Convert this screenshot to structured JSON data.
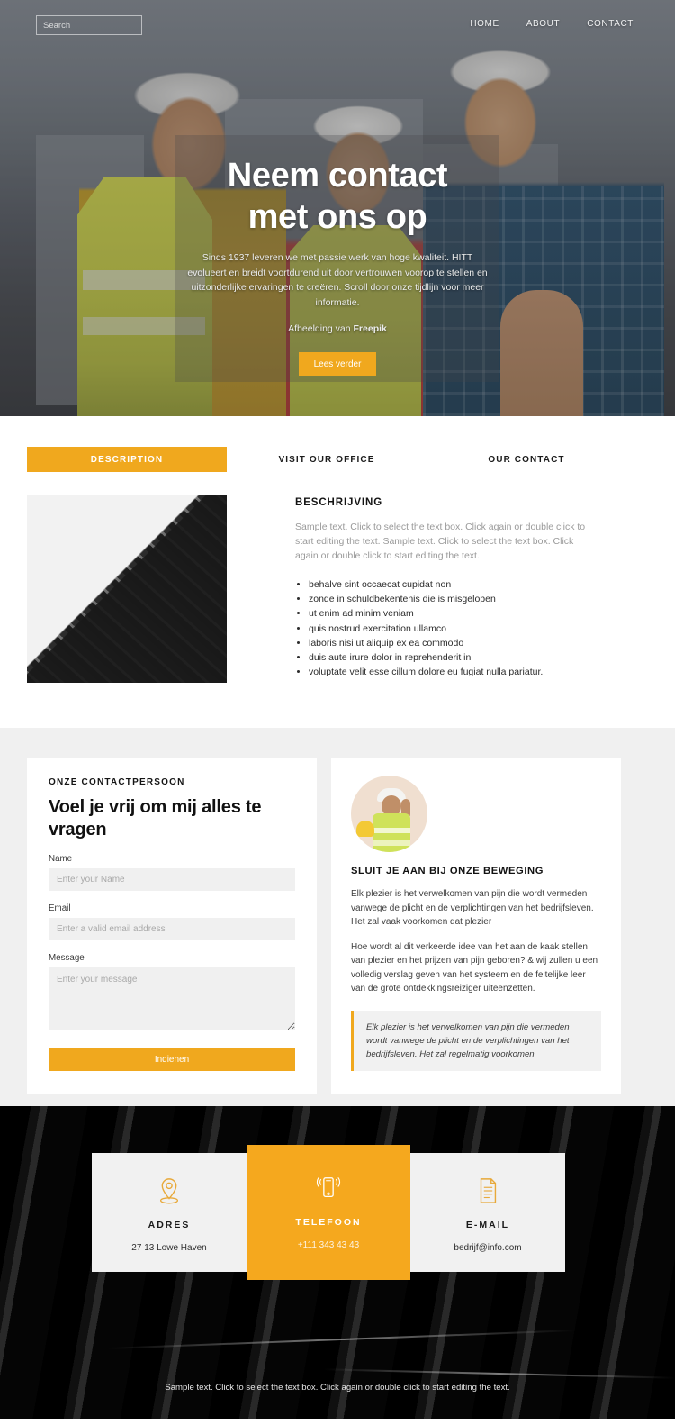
{
  "topbar": {
    "search_placeholder": "Search",
    "search_value": "",
    "nav": [
      {
        "label": "HOME"
      },
      {
        "label": "ABOUT"
      },
      {
        "label": "CONTACT"
      }
    ]
  },
  "hero": {
    "title_line1": "Neem contact",
    "title_line2": "met ons op",
    "subtitle": "Sinds 1937 leveren we met passie werk van hoge kwaliteit. HITT evolueert en breidt voortdurend uit door vertrouwen voorop te stellen en uitzonderlijke ervaringen te creëren. Scroll door onze tijdlijn voor meer informatie.",
    "credit_prefix": "Afbeelding van ",
    "credit_link": "Freepik",
    "button": "Lees verder"
  },
  "tabs": [
    {
      "label": "DESCRIPTION",
      "active": true
    },
    {
      "label": "VISIT OUR OFFICE",
      "active": false
    },
    {
      "label": "OUR CONTACT",
      "active": false
    }
  ],
  "description": {
    "heading": "BESCHRIJVING",
    "paragraph": "Sample text. Click to select the text box. Click again or double click to start editing the text. Sample text. Click to select the text box. Click again or double click to start editing the text.",
    "bullets": [
      "behalve sint occaecat cupidat non",
      "zonde in schuldbekentenis die is misgelopen",
      "ut enim ad minim veniam",
      "quis nostrud exercitation ullamco",
      "laboris nisi ut aliquip ex ea commodo",
      "duis aute irure dolor in reprehenderit in",
      "voluptate velit esse cillum dolore eu fugiat nulla pariatur."
    ]
  },
  "form": {
    "eyebrow": "ONZE CONTACTPERSOON",
    "heading": "Voel je vrij om mij alles te vragen",
    "name_label": "Name",
    "name_placeholder": "Enter your Name",
    "name_value": "",
    "email_label": "Email",
    "email_placeholder": "Enter a valid email address",
    "email_value": "",
    "message_label": "Message",
    "message_placeholder": "Enter your message",
    "message_value": "",
    "submit_label": "Indienen"
  },
  "movement": {
    "heading": "SLUIT JE AAN BIJ ONZE BEWEGING",
    "paragraph1": "Elk plezier is het verwelkomen van pijn die wordt vermeden vanwege de plicht en de verplichtingen van het bedrijfsleven. Het zal vaak voorkomen dat plezier",
    "paragraph2": "Hoe wordt al dit verkeerde idee van het aan de kaak stellen van plezier en het prijzen van pijn geboren? & wij zullen u een volledig verslag geven van het systeem en de feitelijke leer van de grote ontdekkingsreiziger uiteenzetten.",
    "quote": "Elk plezier is het verwelkomen van pijn die vermeden wordt vanwege de plicht en de verplichtingen van het bedrijfsleven. Het zal regelmatig voorkomen"
  },
  "contact_cards": [
    {
      "icon": "map-pin-icon",
      "title": "ADRES",
      "value": "27 13 Lowe Haven",
      "highlight": false
    },
    {
      "icon": "mobile-phone-icon",
      "title": "TELEFOON",
      "value": "+111 343 43 43",
      "highlight": true
    },
    {
      "icon": "document-icon",
      "title": "E-MAIL",
      "value": "bedrijf@info.com",
      "highlight": false
    }
  ],
  "footer": {
    "text": "Sample text. Click to select the text box. Click again or double click to start editing the text."
  },
  "colors": {
    "accent": "#f0a81e",
    "dark": "#050505",
    "light_gray": "#f0f0f0"
  }
}
